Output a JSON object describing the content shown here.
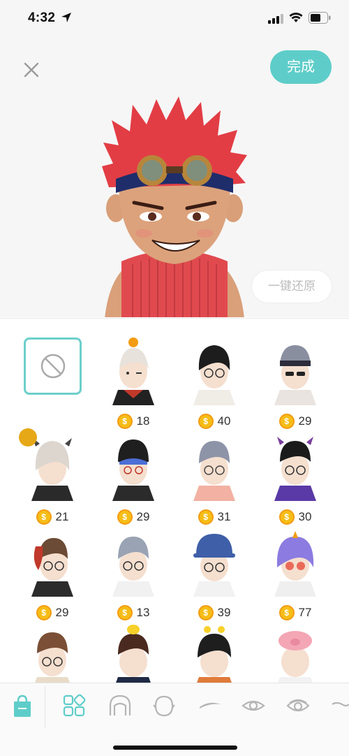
{
  "status_bar": {
    "time": "4:32"
  },
  "preview": {
    "done_label": "完成",
    "reset_label": "一键还原"
  },
  "grid": {
    "items": [
      {
        "price": "18"
      },
      {
        "price": "40"
      },
      {
        "price": "29"
      },
      {
        "price": "21"
      },
      {
        "price": "29"
      },
      {
        "price": "31"
      },
      {
        "price": "30"
      },
      {
        "price": "29"
      },
      {
        "price": "13"
      },
      {
        "price": "39"
      },
      {
        "price": "77"
      }
    ]
  },
  "tabbar": {
    "tabs": [
      "shop-bag-icon",
      "hairstyle-grid-icon",
      "hair-outline-icon",
      "face-shape-icon",
      "eyebrow-icon",
      "eye-icon",
      "eye-shape-icon",
      "mouth-icon"
    ]
  },
  "colors": {
    "accent": "#5ecdc9",
    "coin": "#f6bd16",
    "coin_border": "#f39c12",
    "avatar_hair": "#e23d45",
    "avatar_scarf": "#e04a4f"
  }
}
